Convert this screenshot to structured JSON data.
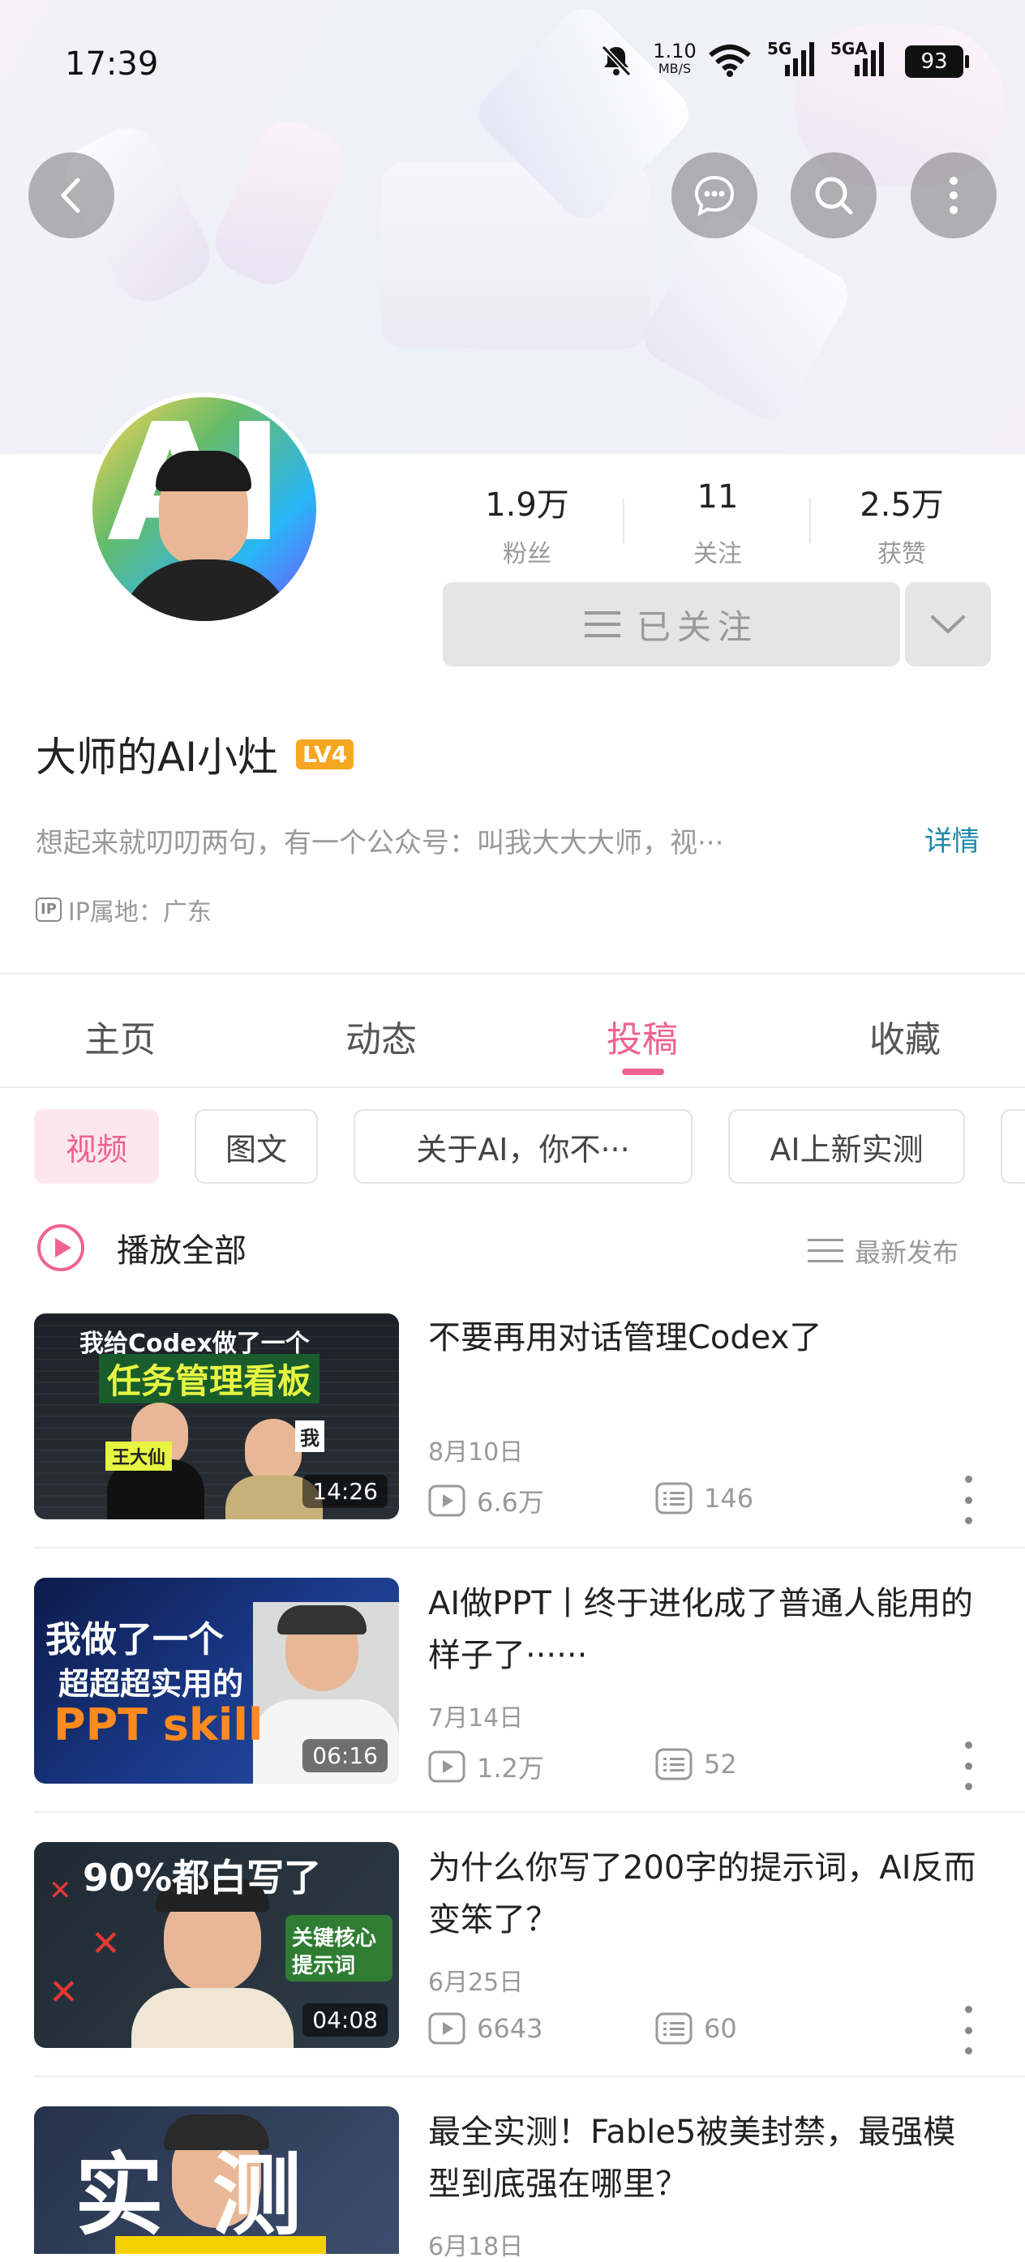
{
  "status_bar": {
    "time": "17:39",
    "net_speed": "1.10",
    "net_unit": "MB/S",
    "sig1": "5G",
    "sig2": "5GA",
    "battery": "93"
  },
  "profile": {
    "avatar_text": "AI",
    "name": "大师的AI小灶",
    "level": "LV4",
    "bio": "想起来就叨叨两句，有一个公众号：叫我大大大师，视···",
    "bio_more": "详情",
    "ip_badge": "IP",
    "ip_text": "IP属地：广东",
    "stats": [
      {
        "value": "1.9万",
        "label": "粉丝"
      },
      {
        "value": "11",
        "label": "关注"
      },
      {
        "value": "2.5万",
        "label": "获赞"
      }
    ],
    "follow_label": "已关注"
  },
  "tabs": [
    {
      "label": "主页",
      "active": false
    },
    {
      "label": "动态",
      "active": false
    },
    {
      "label": "投稿",
      "active": true
    },
    {
      "label": "收藏",
      "active": false
    }
  ],
  "filters": [
    {
      "label": "视频",
      "active": true
    },
    {
      "label": "图文",
      "active": false
    },
    {
      "label": "关于AI，你不···",
      "active": false
    },
    {
      "label": "AI上新实测",
      "active": false
    }
  ],
  "list_header": {
    "play_all": "播放全部",
    "sort": "最新发布"
  },
  "videos": [
    {
      "title": "不要再用对话管理Codex了",
      "date": "8月10日",
      "plays": "6.6万",
      "comments": "146",
      "duration": "14:26",
      "thumb_line1": "我给Codex做了一个",
      "thumb_line2": "任务管理看板",
      "thumb_tag": "王大仙",
      "thumb_tag2": "我"
    },
    {
      "title": "AI做PPT丨终于进化成了普通人能用的样子了······",
      "date": "7月14日",
      "plays": "1.2万",
      "comments": "52",
      "duration": "06:16",
      "thumb_line1": "我做了一个",
      "thumb_line2": "超超超实用的",
      "thumb_line3": "PPT skill"
    },
    {
      "title": "为什么你写了200字的提示词，AI反而变笨了？",
      "date": "6月25日",
      "plays": "6643",
      "comments": "60",
      "duration": "04:08",
      "thumb_line1": "90%都白写了",
      "thumb_line2": "关键核心",
      "thumb_line3": "提示词"
    },
    {
      "title": "最全实测！Fable5被美封禁，最强模型到底强在哪里？",
      "date": "6月18日",
      "thumb_line1": "实测"
    }
  ],
  "colors": {
    "accent": "#f06292",
    "link": "#1e88a8",
    "level_badge": "#f5a623"
  }
}
